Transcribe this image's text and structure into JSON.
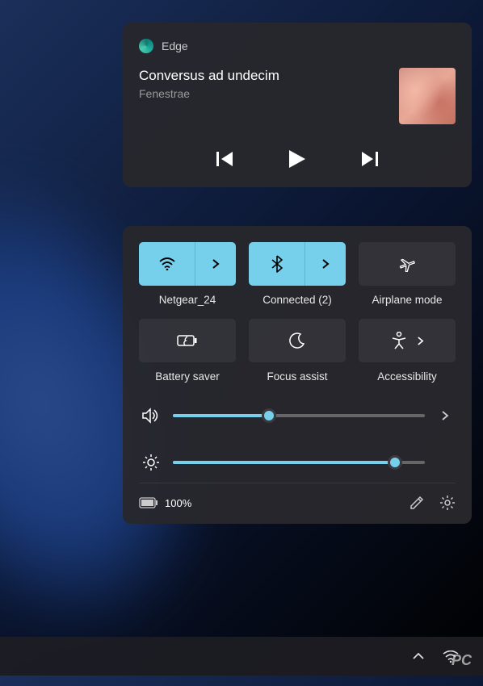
{
  "media": {
    "app": "Edge",
    "title": "Conversus ad undecim",
    "artist": "Fenestrae"
  },
  "tiles": {
    "wifi": {
      "label": "Netgear_24",
      "active": true
    },
    "bluetooth": {
      "label": "Connected (2)",
      "active": true
    },
    "airplane": {
      "label": "Airplane mode",
      "active": false
    },
    "battery_saver": {
      "label": "Battery saver",
      "active": false
    },
    "focus": {
      "label": "Focus assist",
      "active": false
    },
    "accessibility": {
      "label": "Accessibility",
      "active": false
    }
  },
  "sliders": {
    "volume": 38,
    "brightness": 88
  },
  "footer": {
    "battery": "100%"
  },
  "watermark": "PC"
}
